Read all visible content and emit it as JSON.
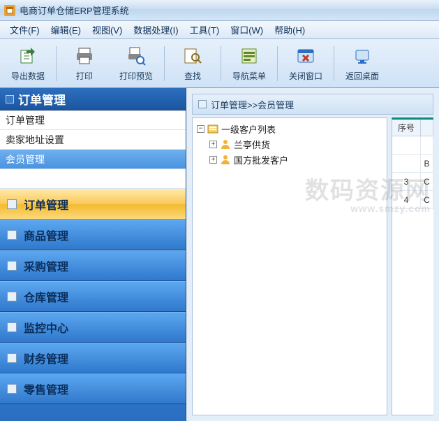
{
  "app": {
    "title": "电商订单仓储ERP管理系统"
  },
  "menu": {
    "file": "文件(F)",
    "edit": "编辑(E)",
    "view": "视图(V)",
    "data": "数据处理(I)",
    "tools": "工具(T)",
    "window": "窗口(W)",
    "help": "帮助(H)"
  },
  "toolbar": {
    "export": "导出数据",
    "print": "打印",
    "preview": "打印预览",
    "find": "查找",
    "navmenu": "导航菜单",
    "closewin": "关闭窗口",
    "back": "返回桌面"
  },
  "sidebar": {
    "header": "订单管理",
    "sub": {
      "order": "订单管理",
      "seller_addr": "卖家地址设置",
      "member": "会员管理"
    },
    "modules": {
      "order": "订单管理",
      "product": "商品管理",
      "purchase": "采购管理",
      "warehouse": "仓库管理",
      "monitor": "监控中心",
      "finance": "财务管理",
      "retail": "零售管理"
    }
  },
  "breadcrumb": {
    "text": "订单管理>>会员管理"
  },
  "tree": {
    "root": "一级客户列表",
    "child1": "兰亭供货",
    "child2": "国方批发客户"
  },
  "grid": {
    "header_seq": "序号",
    "rows": [
      {
        "seq": "",
        "v": ""
      },
      {
        "seq": "",
        "v": "B"
      },
      {
        "seq": "3",
        "v": "C"
      },
      {
        "seq": "4",
        "v": "C"
      }
    ]
  },
  "watermark": {
    "big": "数码资源网",
    "small": "www.smzy.com"
  }
}
